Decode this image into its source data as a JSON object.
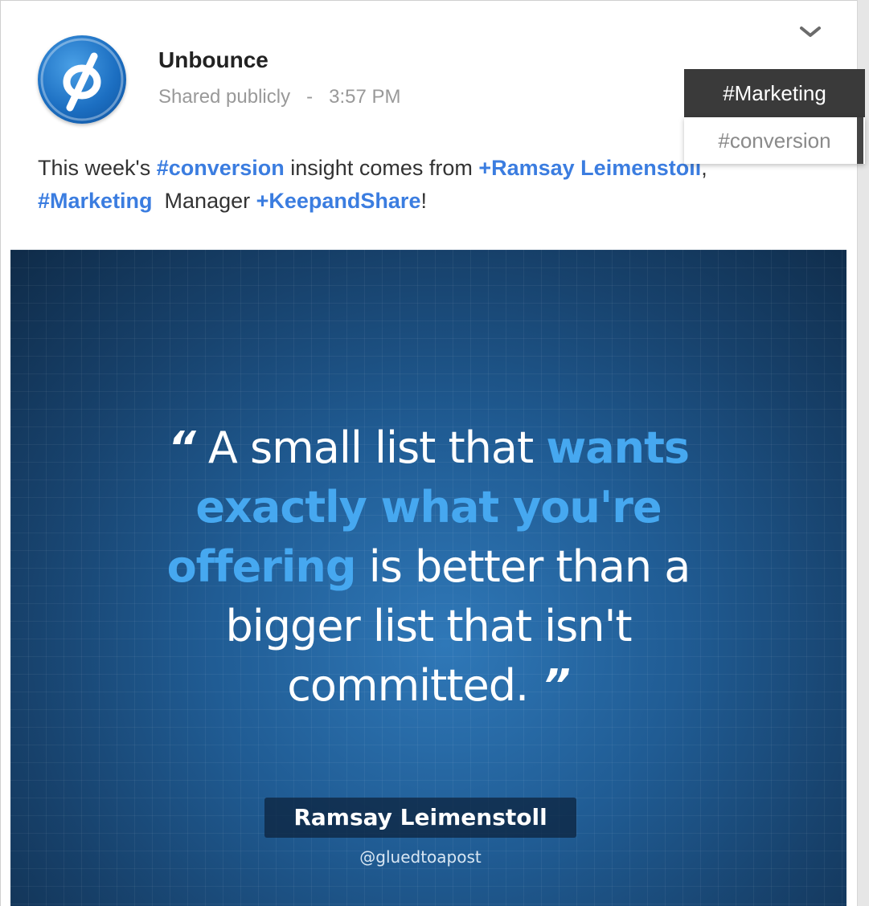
{
  "post": {
    "author": "Unbounce",
    "visibility": "Shared publicly",
    "separator": "-",
    "time": "3:57 PM",
    "text": {
      "p1": "This week's ",
      "tag_conversion": "#conversion",
      "p2": " insight comes from ",
      "mention_ramsay": "+Ramsay Leimenstoll",
      "p3": ",",
      "tag_marketing": "#Marketing",
      "p4": "  Manager ",
      "mention_keepandshare": "+KeepandShare",
      "p5": "!"
    }
  },
  "tooltip": {
    "items": [
      "#Marketing",
      "#conversion"
    ]
  },
  "image": {
    "quote_open": "“",
    "quote_a": " A small list that ",
    "quote_hl1": "wants exactly what you're offering",
    "quote_b": " is better than a bigger list that isn't committed.",
    "quote_close": " ”",
    "author_name": "Ramsay Leimenstoll",
    "author_handle": "@gluedtoapost"
  },
  "icons": {
    "avatar": "unbounce-logo-icon",
    "menu": "chevron-down-icon"
  },
  "colors": {
    "link": "#3b7de0",
    "highlight": "#46a8f0",
    "tooltip_dark": "#3a3a3a"
  }
}
